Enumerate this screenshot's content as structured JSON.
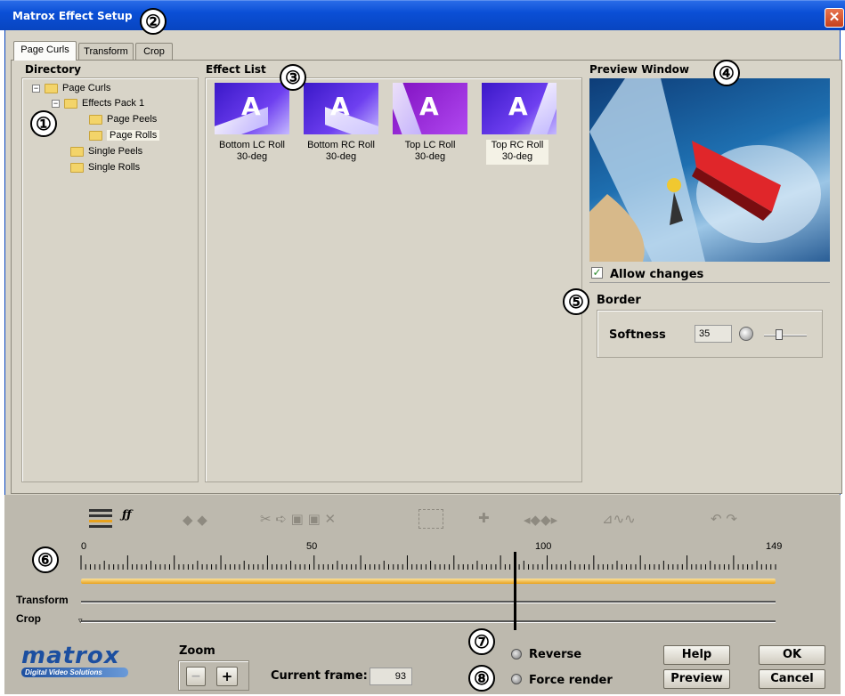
{
  "window": {
    "title": "Matrox Effect Setup",
    "close": "✕"
  },
  "tabs": [
    {
      "label": "Page Curls"
    },
    {
      "label": "Transform"
    },
    {
      "label": "Crop"
    }
  ],
  "directory": {
    "heading": "Directory",
    "items": [
      {
        "label": "Page Curls",
        "toggle": "−"
      },
      {
        "label": "Effects Pack 1",
        "toggle": "−"
      },
      {
        "label": "Page Peels"
      },
      {
        "label": "Page Rolls"
      },
      {
        "label": "Single Peels"
      },
      {
        "label": "Single Rolls"
      }
    ]
  },
  "effect_list": {
    "heading": "Effect List",
    "items": [
      {
        "line1": "Bottom LC Roll",
        "line2": "30-deg"
      },
      {
        "line1": "Bottom RC Roll",
        "line2": "30-deg"
      },
      {
        "line1": "Top LC Roll",
        "line2": "30-deg"
      },
      {
        "line1": "Top RC Roll",
        "line2": "30-deg"
      }
    ],
    "thumb_letter": "A"
  },
  "preview": {
    "heading": "Preview Window",
    "allow_changes": "Allow changes"
  },
  "border": {
    "heading": "Border",
    "softness_label": "Softness",
    "softness_value": "35",
    "softness_level": 0.35
  },
  "timeline": {
    "ticks": [
      "0",
      "50",
      "100",
      "149"
    ],
    "tracks": [
      "Transform",
      "Crop"
    ],
    "current_marker": 93
  },
  "zoom": {
    "label": "Zoom",
    "minus": "−",
    "plus": "+"
  },
  "current_frame": {
    "label": "Current frame:",
    "value": "93"
  },
  "options": {
    "reverse": "Reverse",
    "force_render": "Force render"
  },
  "buttons": {
    "help": "Help",
    "ok": "OK",
    "preview": "Preview",
    "cancel": "Cancel"
  },
  "logo": {
    "name": "matrox",
    "tagline": "Digital Video Solutions"
  },
  "callouts": [
    "①",
    "②",
    "③",
    "④",
    "⑤",
    "⑥",
    "⑦",
    "⑧"
  ],
  "colors": {
    "titlebar": "#0a4fd6",
    "timeline_bar": "#f0b43c",
    "panel": "#d8d4c8"
  }
}
